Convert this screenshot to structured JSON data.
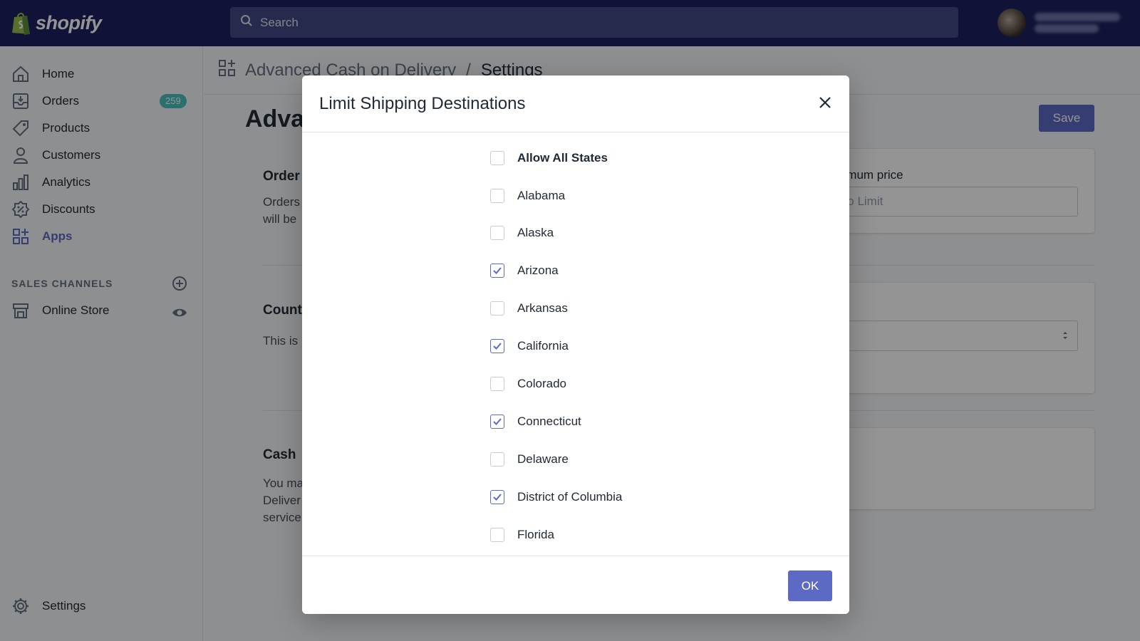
{
  "topbar": {
    "brand": "shopify",
    "search_placeholder": "Search"
  },
  "sidebar": {
    "items": [
      {
        "label": "Home",
        "icon": "home-icon"
      },
      {
        "label": "Orders",
        "icon": "orders-icon",
        "badge": "259"
      },
      {
        "label": "Products",
        "icon": "tag-icon"
      },
      {
        "label": "Customers",
        "icon": "person-icon"
      },
      {
        "label": "Analytics",
        "icon": "bar-chart-icon"
      },
      {
        "label": "Discounts",
        "icon": "discount-icon"
      },
      {
        "label": "Apps",
        "icon": "apps-icon",
        "active": true
      }
    ],
    "sales_channels_title": "SALES CHANNELS",
    "channels": [
      {
        "label": "Online Store",
        "icon": "store-icon"
      }
    ],
    "settings_label": "Settings"
  },
  "page": {
    "breadcrumb_app": "Advanced Cash on Delivery",
    "breadcrumb_separator": "/",
    "breadcrumb_page": "Settings",
    "title_visible": "Adva",
    "save_label": "Save",
    "sections": [
      {
        "heading": "Order",
        "text_lines": [
          "Orders",
          "will be"
        ]
      },
      {
        "heading": "Count",
        "text_lines": [
          "This is"
        ]
      },
      {
        "heading": "Cash",
        "text_lines": [
          "You ma",
          "Deliver",
          "service"
        ]
      }
    ],
    "card1": {
      "label": "ximum price",
      "input_placeholder": "No Limit"
    },
    "card3_text": "."
  },
  "modal": {
    "title": "Limit Shipping Destinations",
    "states": [
      {
        "label": "Allow All States",
        "checked": false,
        "bold": true
      },
      {
        "label": "Alabama",
        "checked": false
      },
      {
        "label": "Alaska",
        "checked": false
      },
      {
        "label": "Arizona",
        "checked": true
      },
      {
        "label": "Arkansas",
        "checked": false
      },
      {
        "label": "California",
        "checked": true
      },
      {
        "label": "Colorado",
        "checked": false
      },
      {
        "label": "Connecticut",
        "checked": true
      },
      {
        "label": "Delaware",
        "checked": false
      },
      {
        "label": "District of Columbia",
        "checked": true
      },
      {
        "label": "Florida",
        "checked": false
      }
    ],
    "ok_label": "OK"
  },
  "colors": {
    "topbar": "#1c2260",
    "accent": "#5c6ac4",
    "badge": "#47c1bf"
  }
}
